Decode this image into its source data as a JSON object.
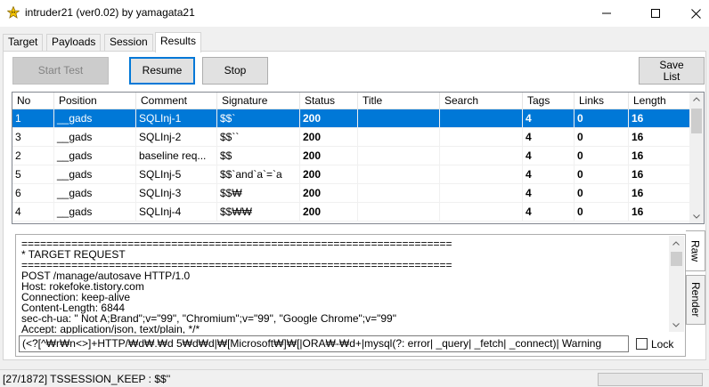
{
  "window": {
    "title": "intruder21  (ver0.02) by yamagata21",
    "minimize_icon": "minimize-icon",
    "maximize_icon": "maximize-icon",
    "close_icon": "close-icon"
  },
  "tabs": [
    {
      "label": "Target",
      "active": false
    },
    {
      "label": "Payloads",
      "active": false
    },
    {
      "label": "Session",
      "active": false
    },
    {
      "label": "Results",
      "active": true
    }
  ],
  "toolbar": {
    "start_label": "Start Test",
    "resume_label": "Resume",
    "stop_label": "Stop",
    "save_label": "Save\nList"
  },
  "grid": {
    "columns": [
      "No",
      "Position",
      "Comment",
      "Signature",
      "Status",
      "Title",
      "Search",
      "Tags",
      "Links",
      "Length"
    ],
    "rows": [
      {
        "no": "1",
        "position": "__gads",
        "comment": "SQLInj-1",
        "signature": "$$`",
        "status": "200",
        "title": "",
        "search": "",
        "tags": "4",
        "links": "0",
        "length": "16",
        "selected": true
      },
      {
        "no": "3",
        "position": "__gads",
        "comment": "SQLInj-2",
        "signature": "$$``",
        "status": "200",
        "title": "",
        "search": "",
        "tags": "4",
        "links": "0",
        "length": "16",
        "selected": false
      },
      {
        "no": "2",
        "position": "__gads",
        "comment": "baseline req...",
        "signature": "$$",
        "status": "200",
        "title": "",
        "search": "",
        "tags": "4",
        "links": "0",
        "length": "16",
        "selected": false
      },
      {
        "no": "5",
        "position": "__gads",
        "comment": "SQLInj-5",
        "signature": "$$`and`a`=`a",
        "status": "200",
        "title": "",
        "search": "",
        "tags": "4",
        "links": "0",
        "length": "16",
        "selected": false
      },
      {
        "no": "6",
        "position": "__gads",
        "comment": "SQLInj-3",
        "signature": "$$₩",
        "status": "200",
        "title": "",
        "search": "",
        "tags": "4",
        "links": "0",
        "length": "16",
        "selected": false
      },
      {
        "no": "4",
        "position": "__gads",
        "comment": "SQLInj-4",
        "signature": "$$₩₩",
        "status": "200",
        "title": "",
        "search": "",
        "tags": "4",
        "links": "0",
        "length": "16",
        "selected": false
      }
    ]
  },
  "raw": {
    "text": "=====================================================================\n* TARGET REQUEST\n=====================================================================\nPOST /manage/autosave HTTP/1.0\nHost: rokefoke.tistory.com\nConnection: keep-alive\nContent-Length: 6844\nsec-ch-ua: \" Not A;Brand\";v=\"99\", \"Chromium\";v=\"99\", \"Google Chrome\";v=\"99\"\nAccept: application/json, text/plain, */*",
    "regex_value": "(<?[^₩r₩n<>]+HTTP/₩d₩.₩d 5₩d₩d|₩[Microsoft₩]₩[|ORA₩-₩d+|mysql(?: error| _query| _fetch| _connect)| Warning",
    "lock_label": "Lock",
    "side_tab_raw": "Raw",
    "side_tab_render": "Render"
  },
  "status": {
    "text": "[27/1872] TSSESSION_KEEP : $$''"
  }
}
